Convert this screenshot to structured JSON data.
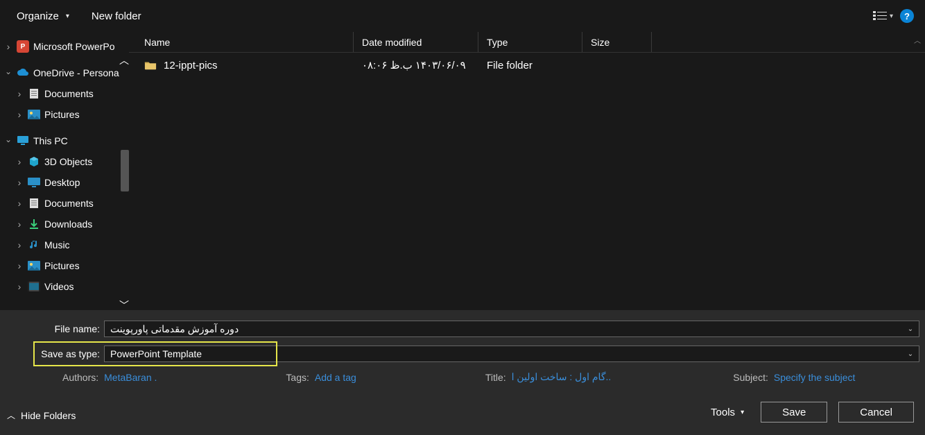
{
  "toolbar": {
    "organize": "Organize",
    "new_folder": "New folder"
  },
  "sidebar": {
    "items": [
      {
        "label": "Microsoft PowerPo",
        "icon": "ppt",
        "chev": "right",
        "indent": 0
      },
      {
        "label": "OneDrive - Persona",
        "icon": "cloud",
        "chev": "down",
        "indent": 0
      },
      {
        "label": "Documents",
        "icon": "doc",
        "chev": "right",
        "indent": 1
      },
      {
        "label": "Pictures",
        "icon": "pic",
        "chev": "right",
        "indent": 1
      },
      {
        "label": "This PC",
        "icon": "pc",
        "chev": "down",
        "indent": 0
      },
      {
        "label": "3D Objects",
        "icon": "3d",
        "chev": "right",
        "indent": 1
      },
      {
        "label": "Desktop",
        "icon": "desktop",
        "chev": "right",
        "indent": 1
      },
      {
        "label": "Documents",
        "icon": "doc",
        "chev": "right",
        "indent": 1
      },
      {
        "label": "Downloads",
        "icon": "down",
        "chev": "right",
        "indent": 1
      },
      {
        "label": "Music",
        "icon": "music",
        "chev": "right",
        "indent": 1
      },
      {
        "label": "Pictures",
        "icon": "pic2",
        "chev": "right",
        "indent": 1
      },
      {
        "label": "Videos",
        "icon": "video",
        "chev": "right",
        "indent": 1
      }
    ]
  },
  "columns": {
    "name": "Name",
    "date": "Date modified",
    "type": "Type",
    "size": "Size"
  },
  "rows": [
    {
      "name": "12-ippt-pics",
      "date": "۱۴۰۳/۰۶/۰۹ ب.ظ ۰۸:۰۶",
      "type": "File folder",
      "size": ""
    }
  ],
  "form": {
    "filename_label": "File name:",
    "filename_value": "دوره آموزش مقدماتی پاورپوینت",
    "savetype_label": "Save as type:",
    "savetype_value": "PowerPoint Template"
  },
  "meta": {
    "authors_label": "Authors:",
    "authors_value": "MetaBaran .",
    "tags_label": "Tags:",
    "tags_value": "Add a tag",
    "title_label": "Title:",
    "title_value": "..گام اول : ساخت اولین ا",
    "subject_label": "Subject:",
    "subject_value": "Specify the subject"
  },
  "footer": {
    "hide_folders": "Hide Folders",
    "tools": "Tools",
    "save": "Save",
    "cancel": "Cancel"
  }
}
